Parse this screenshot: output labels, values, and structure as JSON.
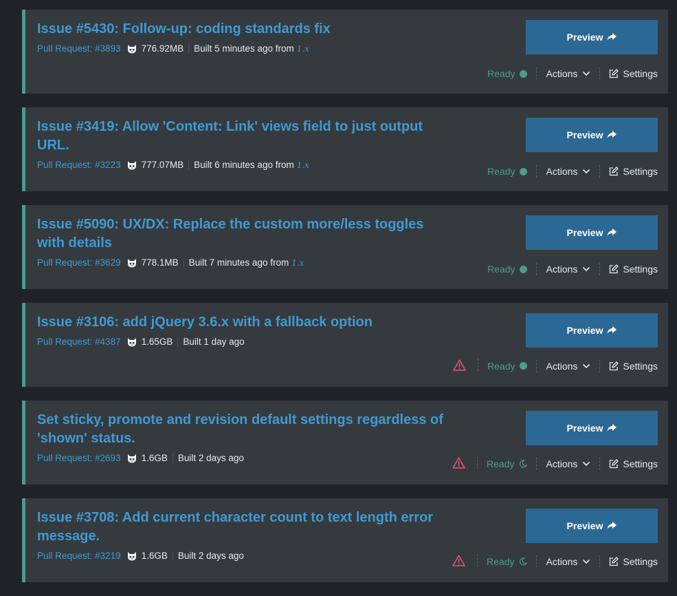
{
  "builds": [
    {
      "title": "Issue #5430: Follow-up: coding standards fix",
      "pull_request": "Pull Request: #3893",
      "size": "776.92MB",
      "built": "Built 5 minutes ago from",
      "branch": "1.x",
      "status": "Ready",
      "status_icon": "dot",
      "warning": false
    },
    {
      "title": "Issue #3419: Allow 'Content: Link' views field to just output URL.",
      "pull_request": "Pull Request: #3223",
      "size": "777.07MB",
      "built": "Built 6 minutes ago from",
      "branch": "1.x",
      "status": "Ready",
      "status_icon": "dot",
      "warning": false
    },
    {
      "title": "Issue #5090: UX/DX: Replace the custom more/less toggles with details",
      "pull_request": "Pull Request: #3629",
      "size": "778.1MB",
      "built": "Built 7 minutes ago from",
      "branch": "1.x",
      "status": "Ready",
      "status_icon": "dot",
      "warning": false
    },
    {
      "title": "Issue #3106: add jQuery 3.6.x with a fallback option",
      "pull_request": "Pull Request: #4387",
      "size": "1.65GB",
      "built": "Built 1 day ago",
      "branch": "",
      "status": "Ready",
      "status_icon": "dot",
      "warning": true
    },
    {
      "title": "Set sticky, promote and revision default settings regardless of 'shown' status.",
      "pull_request": "Pull Request: #2693",
      "size": "1.6GB",
      "built": "Built 2 days ago",
      "branch": "",
      "status": "Ready",
      "status_icon": "moon",
      "warning": true
    },
    {
      "title": "Issue #3708: Add current character count to text length error message.",
      "pull_request": "Pull Request: #3219",
      "size": "1.6GB",
      "built": "Built 2 days ago",
      "branch": "",
      "status": "Ready",
      "status_icon": "moon",
      "warning": true
    }
  ],
  "labels": {
    "preview": "Preview",
    "actions": "Actions",
    "settings": "Settings"
  },
  "icons": {
    "repo": "github-cat-icon",
    "preview": "share-arrow-icon",
    "actions": "chevron-down-icon",
    "settings": "edit-icon",
    "warning": "warning-triangle-icon",
    "status_running": "dot",
    "status_sleeping": "moon-icon"
  },
  "colors": {
    "background": "#1f2226",
    "card": "#353a3f",
    "accent_border": "#4f9a8e",
    "link": "#3f9ad1",
    "button": "#2c6894",
    "ready": "#4f9a8e",
    "warning": "#e0556b",
    "text": "#e8eaed"
  }
}
